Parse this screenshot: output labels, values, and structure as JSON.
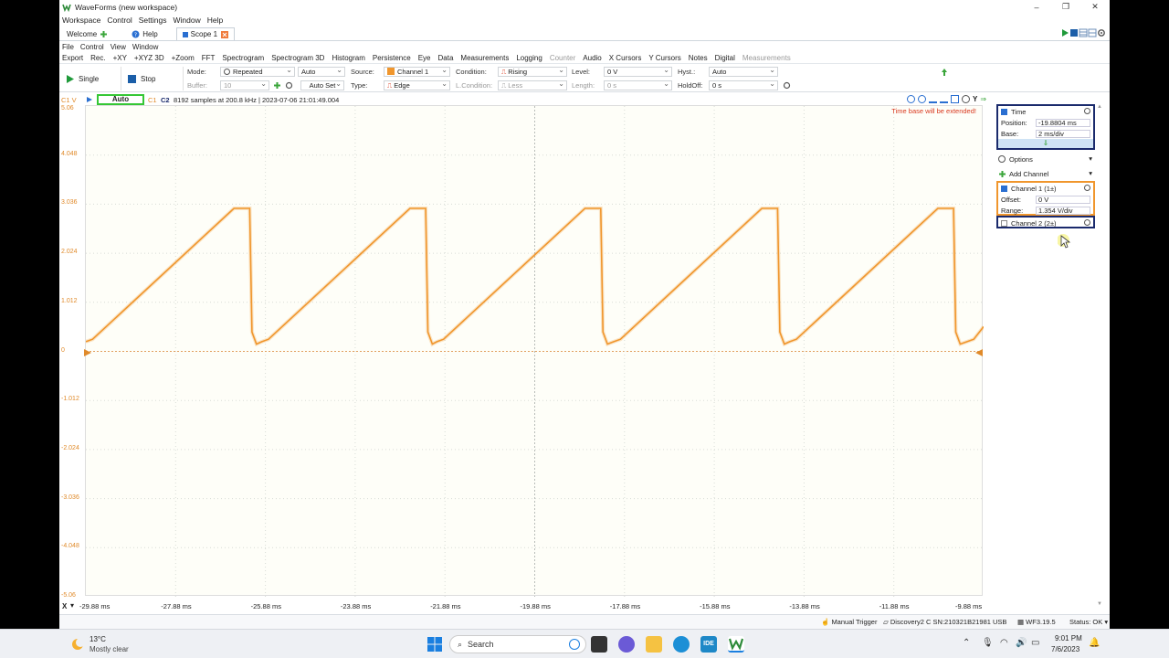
{
  "window": {
    "title": "WaveForms (new workspace)",
    "min": "–",
    "max": "❐",
    "close": "✕"
  },
  "menu": [
    "Workspace",
    "Control",
    "Settings",
    "Window",
    "Help"
  ],
  "tabs": [
    {
      "label": "Welcome"
    },
    {
      "label": "Help"
    },
    {
      "label": "Scope 1"
    }
  ],
  "submenu": [
    "File",
    "Control",
    "View",
    "Window"
  ],
  "toolbar": [
    "Export",
    "Rec.",
    "+XY",
    "+XYZ 3D",
    "+Zoom",
    "FFT",
    "Spectrogram",
    "Spectrogram 3D",
    "Histogram",
    "Persistence",
    "Eye",
    "Data",
    "Measurements",
    "Logging",
    "Counter",
    "Audio",
    "X Cursors",
    "Y Cursors",
    "Notes",
    "Digital",
    "Measurements"
  ],
  "controls": {
    "single": "Single",
    "stop": "Stop",
    "mode_label": "Mode:",
    "mode_value": "Repeated",
    "mode_auto": "Auto",
    "buffer_label": "Buffer:",
    "buffer_value": "10",
    "autoset": "Auto Set",
    "source_label": "Source:",
    "source_value": "Channel 1",
    "type_label": "Type:",
    "type_value": "Edge",
    "condition_label": "Condition:",
    "condition_value": "Rising",
    "lcondition_label": "L.Condition:",
    "lcondition_value": "Less",
    "level_label": "Level:",
    "level_value": "0 V",
    "length_label": "Length:",
    "length_value": "0 s",
    "hyst_label": "Hyst.:",
    "hyst_value": "Auto",
    "holdoff_label": "HoldOff:",
    "holdoff_value": "0 s"
  },
  "info": {
    "c1": "C1 V",
    "auto": "Auto",
    "c1tag": "C1",
    "c2tag": "C2",
    "samples": "8192 samples at 200.8 kHz | 2023-07-06 21:01:49.004",
    "warning": "Time base will be extended!"
  },
  "yticks": [
    "5.06",
    "4.048",
    "3.036",
    "2.024",
    "1.012",
    "0",
    "-1.012",
    "-2.024",
    "-3.036",
    "-4.048",
    "-5.06"
  ],
  "xticks": [
    "-29.88 ms",
    "-27.88 ms",
    "-25.88 ms",
    "-23.88 ms",
    "-21.88 ms",
    "-19.88 ms",
    "-17.88 ms",
    "-15.88 ms",
    "-13.88 ms",
    "-11.88 ms",
    "-9.88 ms"
  ],
  "xaxis_label": "X",
  "panel": {
    "time": "Time",
    "position_label": "Position:",
    "position_value": "-19.8804 ms",
    "base_label": "Base:",
    "base_value": "2 ms/div",
    "options": "Options",
    "add_channel": "Add Channel",
    "ch1": "Channel 1 (1±)",
    "offset_label": "Offset:",
    "offset_value": "0 V",
    "range_label": "Range:",
    "range_value": "1.354 V/div",
    "ch2": "Channel 2 (2±)"
  },
  "status": {
    "trigger": "Manual Trigger",
    "device": "Discovery2 C SN:210321B21981 USB",
    "version": "WF3.19.5",
    "state": "Status: OK"
  },
  "taskbar": {
    "temp": "13°C",
    "weather": "Mostly clear",
    "search": "Search",
    "time": "9:01 PM",
    "date": "7/6/2023"
  },
  "colors": {
    "trace": "#f0962d",
    "frame": "#1a2a6c",
    "auto": "#35c735",
    "ch1": "#f0962d"
  }
}
